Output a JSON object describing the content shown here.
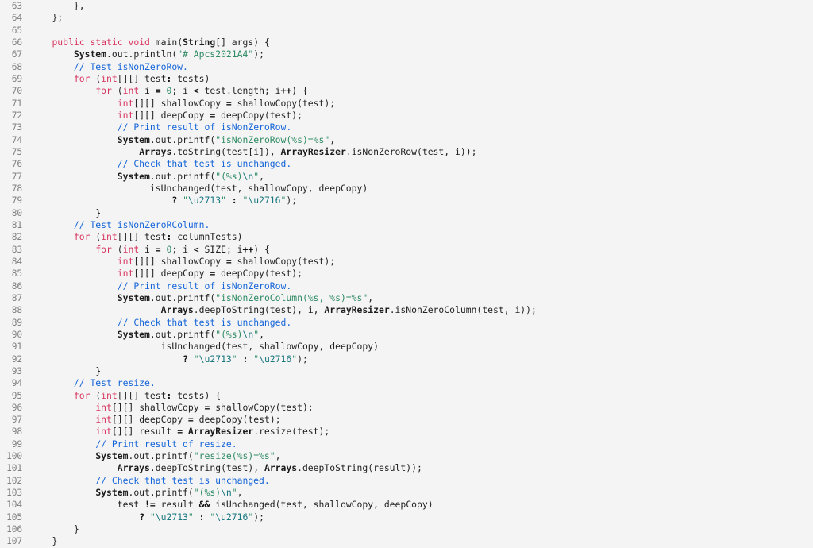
{
  "editor": {
    "language": "java",
    "background": "#f4f4f4",
    "gutter_color": "#818181",
    "first_line_number": 63,
    "last_line_number": 107,
    "colors": {
      "keyword": "#d7345e",
      "comment": "#1565d8",
      "string": "#2e8b64",
      "escape": "#17777f",
      "number": "#2e8b64",
      "class_name": "#1b1b1b",
      "operator": "#111111",
      "plain": "#222222"
    }
  },
  "lines": [
    {
      "n": "63",
      "text": "        },"
    },
    {
      "n": "64",
      "text": "    };"
    },
    {
      "n": "65",
      "text": ""
    },
    {
      "n": "66",
      "text": "    public static void main(String[] args) {"
    },
    {
      "n": "67",
      "text": "        System.out.println(\"# Apcs2021A4\");"
    },
    {
      "n": "68",
      "text": "        // Test isNonZeroRow."
    },
    {
      "n": "69",
      "text": "        for (int[][] test: tests)"
    },
    {
      "n": "70",
      "text": "            for (int i = 0; i < test.length; i++) {"
    },
    {
      "n": "71",
      "text": "                int[][] shallowCopy = shallowCopy(test);"
    },
    {
      "n": "72",
      "text": "                int[][] deepCopy = deepCopy(test);"
    },
    {
      "n": "73",
      "text": "                // Print result of isNonZeroRow."
    },
    {
      "n": "74",
      "text": "                System.out.printf(\"isNonZeroRow(%s)=%s\","
    },
    {
      "n": "75",
      "text": "                    Arrays.toString(test[i]), ArrayResizer.isNonZeroRow(test, i));"
    },
    {
      "n": "76",
      "text": "                // Check that test is unchanged."
    },
    {
      "n": "77",
      "text": "                System.out.printf(\"(%s)\\n\","
    },
    {
      "n": "78",
      "text": "                      isUnchanged(test, shallowCopy, deepCopy)"
    },
    {
      "n": "79",
      "text": "                          ? \"\\u2713\" : \"\\u2716\");"
    },
    {
      "n": "80",
      "text": "            }"
    },
    {
      "n": "81",
      "text": "        // Test isNonZeroRColumn."
    },
    {
      "n": "82",
      "text": "        for (int[][] test: columnTests)"
    },
    {
      "n": "83",
      "text": "            for (int i = 0; i < SIZE; i++) {"
    },
    {
      "n": "84",
      "text": "                int[][] shallowCopy = shallowCopy(test);"
    },
    {
      "n": "85",
      "text": "                int[][] deepCopy = deepCopy(test);"
    },
    {
      "n": "86",
      "text": "                // Print result of isNonZeroRow."
    },
    {
      "n": "87",
      "text": "                System.out.printf(\"isNonZeroColumn(%s, %s)=%s\","
    },
    {
      "n": "88",
      "text": "                        Arrays.deepToString(test), i, ArrayResizer.isNonZeroColumn(test, i));"
    },
    {
      "n": "89",
      "text": "                // Check that test is unchanged."
    },
    {
      "n": "90",
      "text": "                System.out.printf(\"(%s)\\n\","
    },
    {
      "n": "91",
      "text": "                        isUnchanged(test, shallowCopy, deepCopy)"
    },
    {
      "n": "92",
      "text": "                            ? \"\\u2713\" : \"\\u2716\");"
    },
    {
      "n": "93",
      "text": "            }"
    },
    {
      "n": "94",
      "text": "        // Test resize."
    },
    {
      "n": "95",
      "text": "        for (int[][] test: tests) {"
    },
    {
      "n": "96",
      "text": "            int[][] shallowCopy = shallowCopy(test);"
    },
    {
      "n": "97",
      "text": "            int[][] deepCopy = deepCopy(test);"
    },
    {
      "n": "98",
      "text": "            int[][] result = ArrayResizer.resize(test);"
    },
    {
      "n": "99",
      "text": "            // Print result of resize."
    },
    {
      "n": "100",
      "text": "            System.out.printf(\"resize(%s)=%s\","
    },
    {
      "n": "101",
      "text": "                Arrays.deepToString(test), Arrays.deepToString(result));"
    },
    {
      "n": "102",
      "text": "            // Check that test is unchanged."
    },
    {
      "n": "103",
      "text": "            System.out.printf(\"(%s)\\n\","
    },
    {
      "n": "104",
      "text": "                test != result && isUnchanged(test, shallowCopy, deepCopy)"
    },
    {
      "n": "105",
      "text": "                    ? \"\\u2713\" : \"\\u2716\");"
    },
    {
      "n": "106",
      "text": "        }"
    },
    {
      "n": "107",
      "text": "    }"
    }
  ]
}
